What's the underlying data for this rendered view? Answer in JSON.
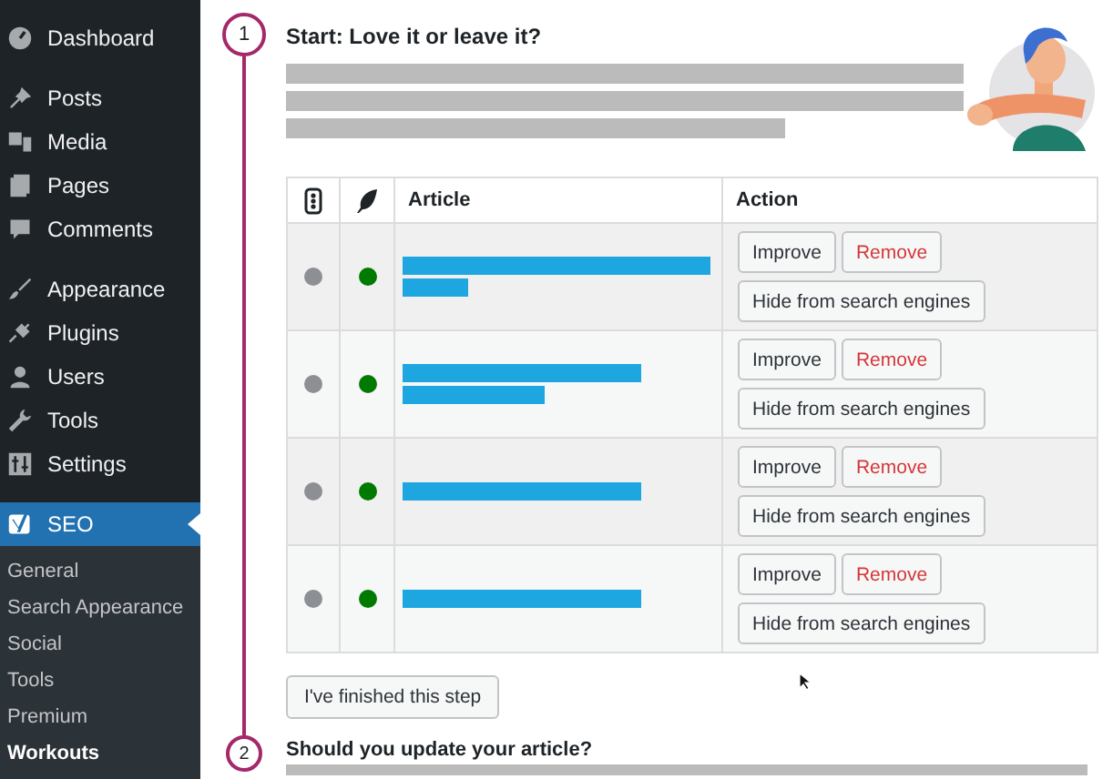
{
  "sidebar": {
    "groups": [
      [
        {
          "label": "Dashboard",
          "kind": "dashboard",
          "selected": false
        }
      ],
      [
        {
          "label": "Posts",
          "kind": "pin",
          "selected": false
        },
        {
          "label": "Media",
          "kind": "media",
          "selected": false
        },
        {
          "label": "Pages",
          "kind": "pages",
          "selected": false
        },
        {
          "label": "Comments",
          "kind": "comments",
          "selected": false
        }
      ],
      [
        {
          "label": "Appearance",
          "kind": "brush",
          "selected": false
        },
        {
          "label": "Plugins",
          "kind": "plug",
          "selected": false
        },
        {
          "label": "Users",
          "kind": "user",
          "selected": false
        },
        {
          "label": "Tools",
          "kind": "wrench",
          "selected": false
        },
        {
          "label": "Settings",
          "kind": "sliders",
          "selected": false
        }
      ],
      [
        {
          "label": "SEO",
          "kind": "logo",
          "selected": true
        }
      ]
    ],
    "submenu": [
      {
        "label": "General",
        "selected": false
      },
      {
        "label": "Search Appearance",
        "selected": false
      },
      {
        "label": "Social",
        "selected": false
      },
      {
        "label": "Tools",
        "selected": false
      },
      {
        "label": "Premium",
        "selected": false
      },
      {
        "label": "Workouts",
        "selected": true
      }
    ]
  },
  "steps": [
    {
      "number": "1",
      "title": "Start: Love it or leave it?",
      "table": {
        "columns": [
          {
            "kind": "readability"
          },
          {
            "kind": "seo"
          },
          {
            "kind": "text",
            "label": "Article"
          },
          {
            "kind": "text",
            "label": "Action"
          }
        ],
        "rows": [
          {
            "dots": [
              {
                "color": "#8c8f94"
              },
              {
                "color": "#007a00"
              }
            ],
            "actions": [
              {
                "label": "Improve",
                "kind": "default"
              },
              {
                "label": "Remove",
                "kind": "danger"
              },
              {
                "label": "Hide from search engines",
                "kind": "default"
              }
            ]
          },
          {
            "dots": [
              {
                "color": "#8c8f94"
              },
              {
                "color": "#007a00"
              }
            ],
            "actions": [
              {
                "label": "Improve",
                "kind": "default"
              },
              {
                "label": "Remove",
                "kind": "danger"
              },
              {
                "label": "Hide from search engines",
                "kind": "default"
              }
            ]
          },
          {
            "dots": [
              {
                "color": "#8c8f94"
              },
              {
                "color": "#007a00"
              }
            ],
            "actions": [
              {
                "label": "Improve",
                "kind": "default"
              },
              {
                "label": "Remove",
                "kind": "danger"
              },
              {
                "label": "Hide from search engines",
                "kind": "default"
              }
            ]
          },
          {
            "dots": [
              {
                "color": "#8c8f94"
              },
              {
                "color": "#007a00"
              }
            ],
            "actions": [
              {
                "label": "Improve",
                "kind": "default"
              },
              {
                "label": "Remove",
                "kind": "danger"
              },
              {
                "label": "Hide from search engines",
                "kind": "default"
              }
            ]
          }
        ]
      },
      "finish_button": "I've finished this step"
    },
    {
      "number": "2",
      "title": "Should you update your article?"
    }
  ]
}
